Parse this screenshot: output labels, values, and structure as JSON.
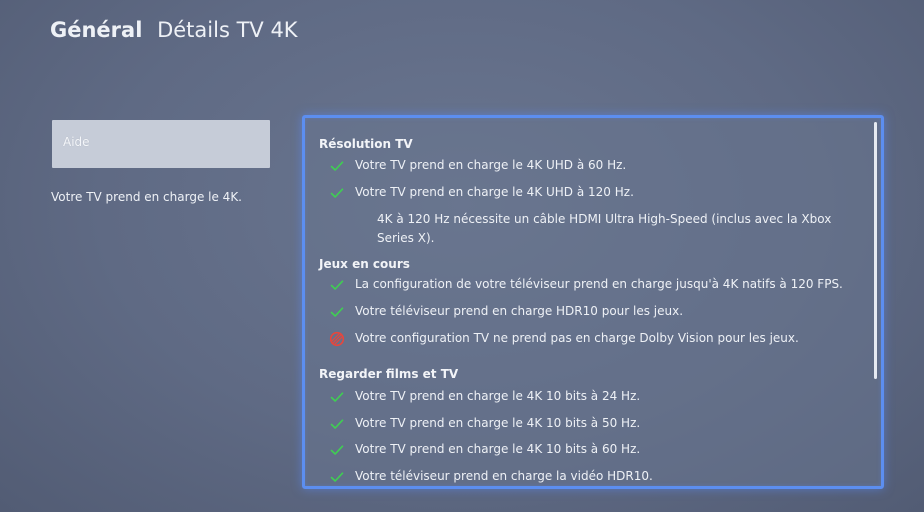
{
  "header": {
    "section": "Général",
    "page": "Détails TV 4K"
  },
  "sidebar": {
    "help_button_label": "Aide",
    "summary": "Votre TV prend en charge le 4K."
  },
  "details": {
    "resolution": {
      "title": "Résolution TV",
      "items": [
        {
          "status": "ok",
          "text": "Votre TV prend en charge le 4K UHD à 60 Hz."
        },
        {
          "status": "ok",
          "text": "Votre TV prend en charge le 4K UHD à 120 Hz."
        }
      ],
      "note": "4K à 120 Hz nécessite un câble HDMI Ultra High-Speed (inclus avec la Xbox Series X)."
    },
    "gaming": {
      "title": "Jeux en cours",
      "items": [
        {
          "status": "ok",
          "text": "La configuration de votre téléviseur prend en charge jusqu'à 4K natifs à 120 FPS."
        },
        {
          "status": "ok",
          "text": "Votre téléviseur prend en charge HDR10 pour les jeux."
        },
        {
          "status": "unsupported",
          "text": "Votre configuration TV ne prend pas en charge Dolby Vision pour les jeux."
        }
      ]
    },
    "media": {
      "title": "Regarder films et TV",
      "items": [
        {
          "status": "ok",
          "text": "Votre TV prend en charge le 4K 10 bits à 24 Hz."
        },
        {
          "status": "ok",
          "text": "Votre TV prend en charge le 4K 10 bits à 50 Hz."
        },
        {
          "status": "ok",
          "text": "Votre TV prend en charge le 4K 10 bits à 60 Hz."
        },
        {
          "status": "ok",
          "text": "Votre téléviseur prend en charge la vidéo HDR10."
        }
      ]
    }
  },
  "icons": {
    "ok": "check-icon",
    "unsupported": "blocked-icon"
  },
  "colors": {
    "check": "#3fcf52",
    "blocked": "#e8463c",
    "focus_border": "#5c8ef0"
  }
}
